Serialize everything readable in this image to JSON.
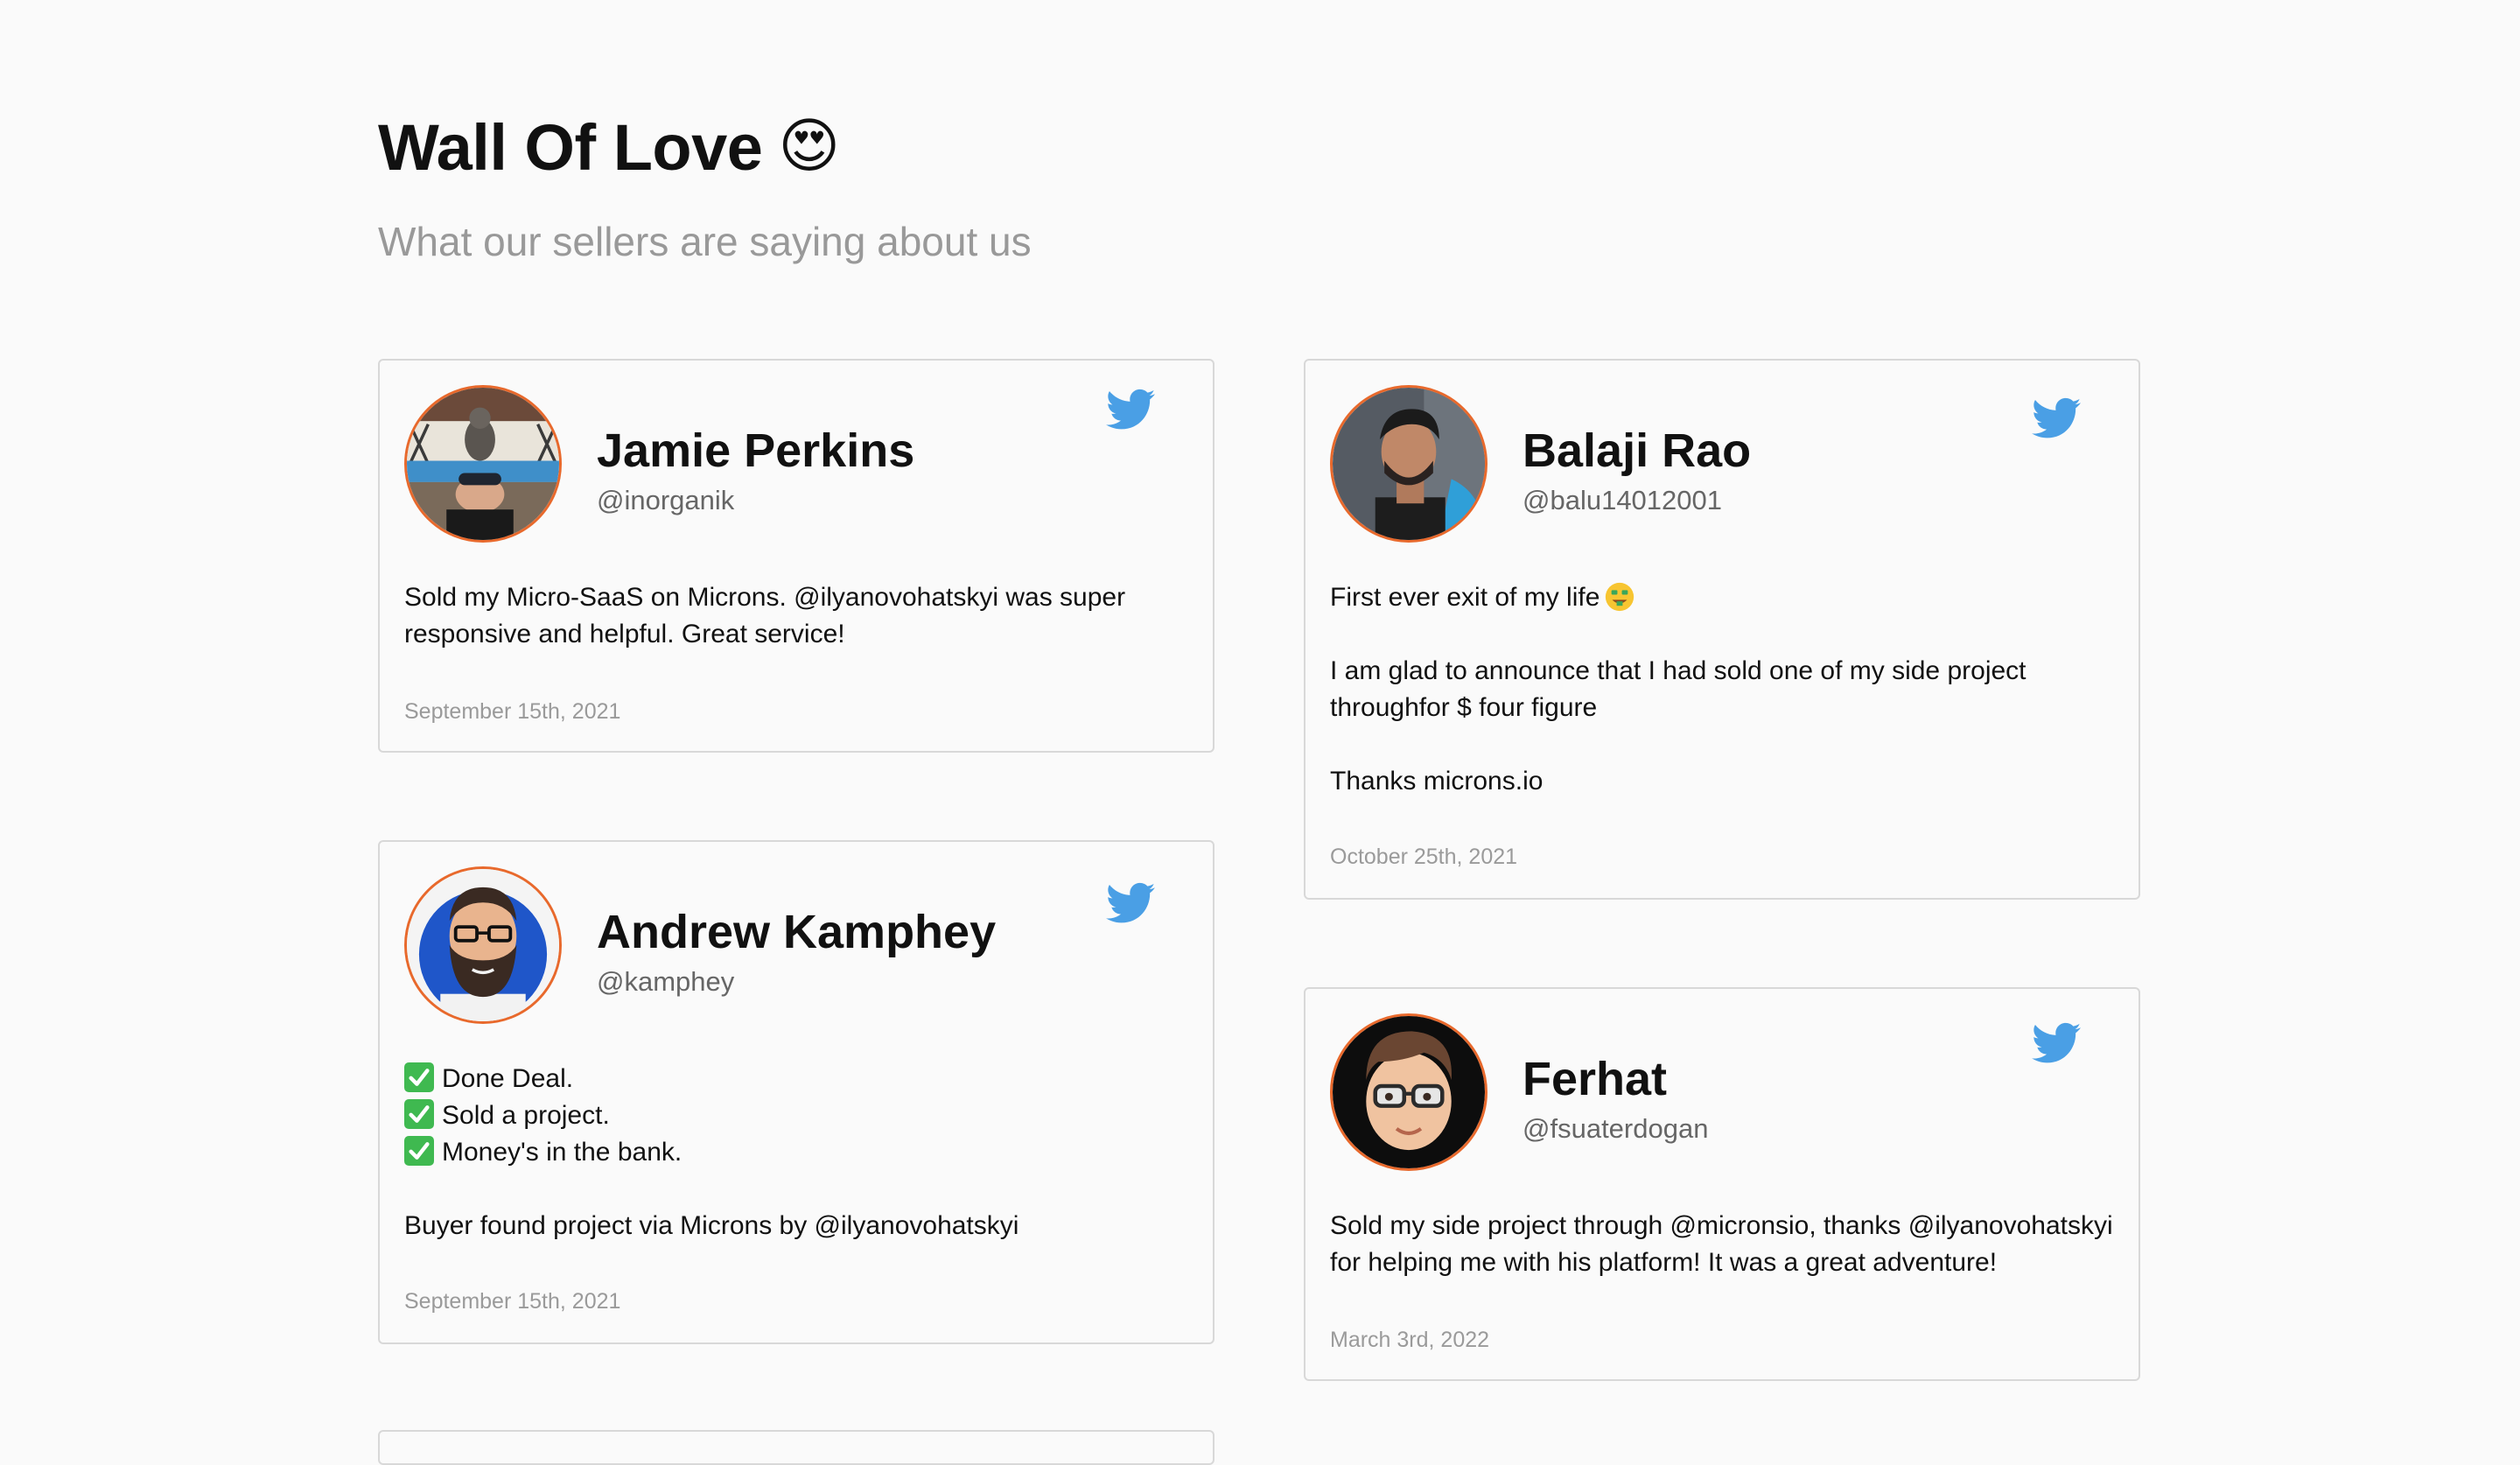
{
  "header": {
    "title": "Wall Of Love",
    "emoji": "😍",
    "subtitle": "What our sellers are saying about us"
  },
  "colors": {
    "background": "#fafafa",
    "twitter_blue": "#4a9fe5",
    "avatar_ring": "#e8692c",
    "muted_text": "#999999",
    "check_green": "#3fb950"
  },
  "testimonials": [
    {
      "name": "Jamie Perkins",
      "handle": "@inorganik",
      "icon": "twitter-icon",
      "body": [
        "Sold my Micro-SaaS on Microns. @ilyanovohatskyi was super responsive and helpful. Great service!"
      ],
      "date": "September 15th, 2021"
    },
    {
      "name": "Balaji Rao",
      "handle": "@balu14012001",
      "icon": "twitter-icon",
      "body": [
        "First ever exit of my life",
        "I am glad to announce that I had sold one of my side project throughfor $ four figure",
        "Thanks microns.io"
      ],
      "date": "October 25th, 2021"
    },
    {
      "name": "Andrew Kamphey",
      "handle": "@kamphey",
      "icon": "twitter-icon",
      "body": [
        "Done Deal.",
        "Sold a project.",
        "Money's in the bank.",
        "Buyer found project via Microns by @ilyanovohatskyi"
      ],
      "date": "September 15th, 2021"
    },
    {
      "name": "Ferhat",
      "handle": "@fsuaterdogan",
      "icon": "twitter-icon",
      "body": [
        "Sold my side project through @micronsio, thanks @ilyanovohatskyi for helping me with his platform! It was a great adventure!"
      ],
      "date": "March 3rd, 2022"
    }
  ]
}
